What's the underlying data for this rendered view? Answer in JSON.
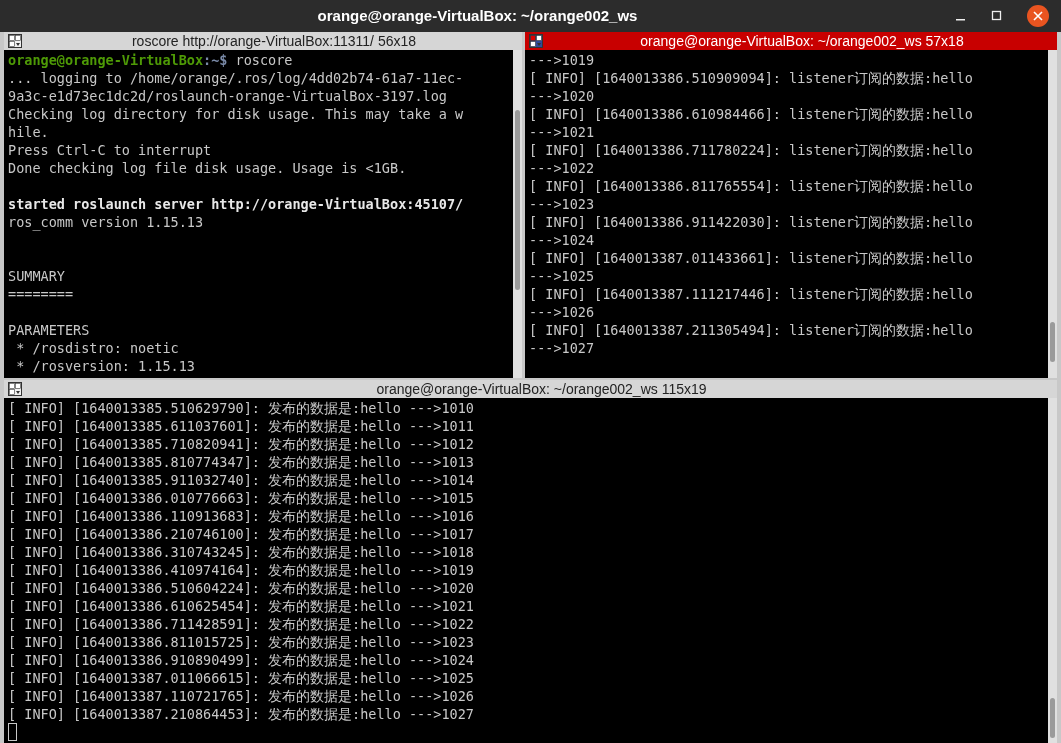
{
  "window": {
    "title": "orange@orange-VirtualBox: ~/orange002_ws"
  },
  "panes": [
    {
      "title": "roscore http://orange-VirtualBox:11311/ 56x18",
      "focused": false,
      "lines": [
        {
          "kind": "prompt",
          "user": "orange@orange-VirtualBox",
          "path": ":~$",
          "text": " roscore"
        },
        {
          "kind": "text",
          "text": "... logging to /home/orange/.ros/log/4dd02b74-61a7-11ec-"
        },
        {
          "kind": "text",
          "text": "9a3c-e1d73ec1dc2d/roslaunch-orange-VirtualBox-3197.log"
        },
        {
          "kind": "text",
          "text": "Checking log directory for disk usage. This may take a w"
        },
        {
          "kind": "text",
          "text": "hile."
        },
        {
          "kind": "text",
          "text": "Press Ctrl-C to interrupt"
        },
        {
          "kind": "text",
          "text": "Done checking log file disk usage. Usage is <1GB."
        },
        {
          "kind": "blank"
        },
        {
          "kind": "bold",
          "text": "started roslaunch server http://orange-VirtualBox:45107/"
        },
        {
          "kind": "text",
          "text": "ros_comm version 1.15.13"
        },
        {
          "kind": "blank"
        },
        {
          "kind": "blank"
        },
        {
          "kind": "text",
          "text": "SUMMARY"
        },
        {
          "kind": "text",
          "text": "========"
        },
        {
          "kind": "blank"
        },
        {
          "kind": "text",
          "text": "PARAMETERS"
        },
        {
          "kind": "text",
          "text": " * /rosdistro: noetic"
        },
        {
          "kind": "text",
          "text": " * /rosversion: 1.15.13"
        }
      ]
    },
    {
      "title": "orange@orange-VirtualBox: ~/orange002_ws 57x18",
      "focused": true,
      "lines": [
        {
          "kind": "text",
          "text": "--->1019"
        },
        {
          "kind": "text",
          "text": "[ INFO] [1640013386.510909094]: listener订阅的数据:hello"
        },
        {
          "kind": "text",
          "text": "--->1020"
        },
        {
          "kind": "text",
          "text": "[ INFO] [1640013386.610984466]: listener订阅的数据:hello"
        },
        {
          "kind": "text",
          "text": "--->1021"
        },
        {
          "kind": "text",
          "text": "[ INFO] [1640013386.711780224]: listener订阅的数据:hello"
        },
        {
          "kind": "text",
          "text": "--->1022"
        },
        {
          "kind": "text",
          "text": "[ INFO] [1640013386.811765554]: listener订阅的数据:hello"
        },
        {
          "kind": "text",
          "text": "--->1023"
        },
        {
          "kind": "text",
          "text": "[ INFO] [1640013386.911422030]: listener订阅的数据:hello"
        },
        {
          "kind": "text",
          "text": "--->1024"
        },
        {
          "kind": "text",
          "text": "[ INFO] [1640013387.011433661]: listener订阅的数据:hello"
        },
        {
          "kind": "text",
          "text": "--->1025"
        },
        {
          "kind": "text",
          "text": "[ INFO] [1640013387.111217446]: listener订阅的数据:hello"
        },
        {
          "kind": "text",
          "text": "--->1026"
        },
        {
          "kind": "text",
          "text": "[ INFO] [1640013387.211305494]: listener订阅的数据:hello"
        },
        {
          "kind": "text",
          "text": "--->1027"
        }
      ]
    },
    {
      "title": "orange@orange-VirtualBox: ~/orange002_ws 115x19",
      "focused": false,
      "lines": [
        {
          "kind": "text",
          "text": "[ INFO] [1640013385.510629790]: 发布的数据是:hello --->1010"
        },
        {
          "kind": "text",
          "text": "[ INFO] [1640013385.611037601]: 发布的数据是:hello --->1011"
        },
        {
          "kind": "text",
          "text": "[ INFO] [1640013385.710820941]: 发布的数据是:hello --->1012"
        },
        {
          "kind": "text",
          "text": "[ INFO] [1640013385.810774347]: 发布的数据是:hello --->1013"
        },
        {
          "kind": "text",
          "text": "[ INFO] [1640013385.911032740]: 发布的数据是:hello --->1014"
        },
        {
          "kind": "text",
          "text": "[ INFO] [1640013386.010776663]: 发布的数据是:hello --->1015"
        },
        {
          "kind": "text",
          "text": "[ INFO] [1640013386.110913683]: 发布的数据是:hello --->1016"
        },
        {
          "kind": "text",
          "text": "[ INFO] [1640013386.210746100]: 发布的数据是:hello --->1017"
        },
        {
          "kind": "text",
          "text": "[ INFO] [1640013386.310743245]: 发布的数据是:hello --->1018"
        },
        {
          "kind": "text",
          "text": "[ INFO] [1640013386.410974164]: 发布的数据是:hello --->1019"
        },
        {
          "kind": "text",
          "text": "[ INFO] [1640013386.510604224]: 发布的数据是:hello --->1020"
        },
        {
          "kind": "text",
          "text": "[ INFO] [1640013386.610625454]: 发布的数据是:hello --->1021"
        },
        {
          "kind": "text",
          "text": "[ INFO] [1640013386.711428591]: 发布的数据是:hello --->1022"
        },
        {
          "kind": "text",
          "text": "[ INFO] [1640013386.811015725]: 发布的数据是:hello --->1023"
        },
        {
          "kind": "text",
          "text": "[ INFO] [1640013386.910890499]: 发布的数据是:hello --->1024"
        },
        {
          "kind": "text",
          "text": "[ INFO] [1640013387.011066615]: 发布的数据是:hello --->1025"
        },
        {
          "kind": "text",
          "text": "[ INFO] [1640013387.110721765]: 发布的数据是:hello --->1026"
        },
        {
          "kind": "text",
          "text": "[ INFO] [1640013387.210864453]: 发布的数据是:hello --->1027"
        },
        {
          "kind": "cursor"
        }
      ]
    }
  ]
}
